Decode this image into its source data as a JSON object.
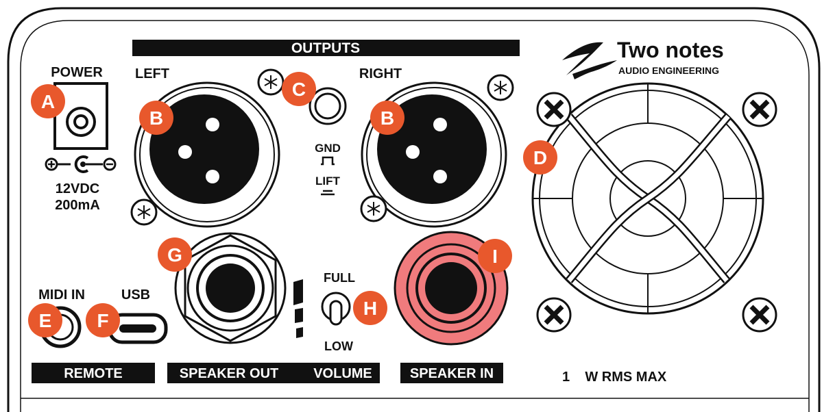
{
  "colors": {
    "ink": "#111111",
    "badge": "#e8582c",
    "speaker_in": "#f07b7d",
    "background": "#ffffff"
  },
  "labels": {
    "outputs": "OUTPUTS",
    "power": "POWER",
    "left": "LEFT",
    "right": "RIGHT",
    "gnd": "GND",
    "lift": "LIFT",
    "dc_line1": "12VDC",
    "dc_line2": "200mA",
    "midi_in": "MIDI IN",
    "usb": "USB",
    "full": "FULL",
    "low": "LOW",
    "remote": "REMOTE",
    "speaker_out": "SPEAKER OUT",
    "volume": "VOLUME",
    "speaker_in": "SPEAKER IN",
    "rms": "1    W RMS MAX"
  },
  "logo": {
    "brand": "Two notes",
    "tagline": "AUDIO ENGINEERING",
    "icon": "two-notes-logo-icon"
  },
  "badges": {
    "a": "A",
    "b_left": "B",
    "b_right": "B",
    "c": "C",
    "d": "D",
    "e": "E",
    "f": "F",
    "g": "G",
    "h": "H",
    "i": "I"
  }
}
